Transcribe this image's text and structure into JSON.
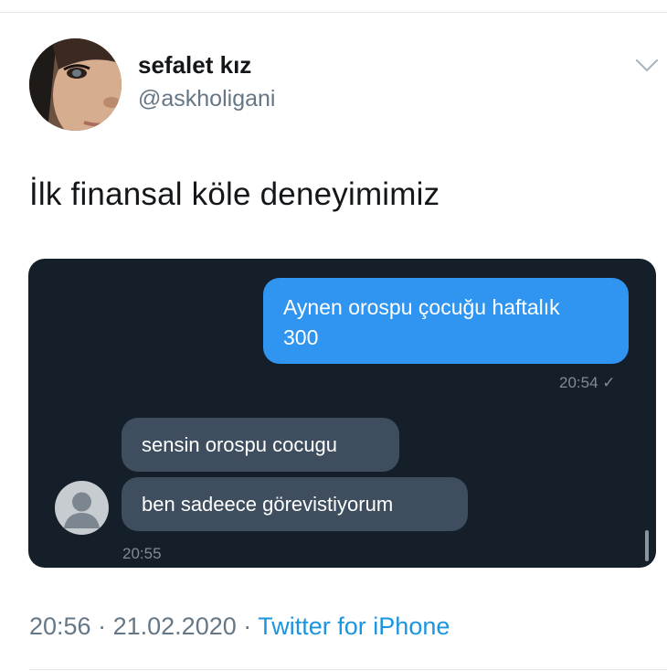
{
  "tweet": {
    "display_name": "sefalet kız",
    "handle": "@askholigani",
    "text": "İlk finansal köle deneyimimiz",
    "time": "20:56",
    "separator": "·",
    "date": "21.02.2020",
    "source": "Twitter for iPhone"
  },
  "chat": {
    "outgoing": {
      "line1": "Aynen orospu çocuğu haftalık",
      "line2": "300",
      "time": "20:54 ✓"
    },
    "incoming": [
      {
        "text": "sensin orospu cocugu"
      },
      {
        "text": "ben sadeece görevistiyorum"
      }
    ],
    "incoming_time": "20:55"
  },
  "colors": {
    "chat_background": "#151f2a",
    "outgoing_bubble": "#2f95f0",
    "incoming_bubble": "#3e4e5e",
    "link": "#1b95e0",
    "secondary_text": "#657786"
  },
  "icons": {
    "more": "chevron-down-icon",
    "contact": "default-user-avatar-icon"
  }
}
